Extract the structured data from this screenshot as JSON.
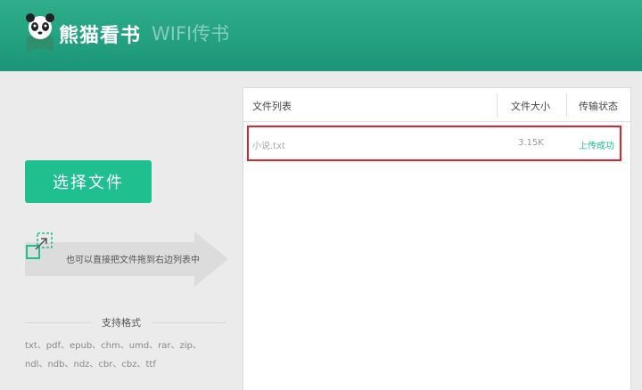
{
  "header": {
    "app_name": "熊猫看书",
    "subtitle": "WIFI传书"
  },
  "left": {
    "select_button": "选择文件",
    "drag_hint": "也可以直接把文件拖到右边列表中",
    "formats_title": "支持格式",
    "formats_line1": "txt、pdf、epub、chm、umd、rar、zip、",
    "formats_line2": "ndl、ndb、ndz、cbr、cbz、ttf"
  },
  "table": {
    "columns": [
      "文件列表",
      "文件大小",
      "传输状态"
    ],
    "rows": [
      {
        "name": "小说.txt",
        "size": "3.15K",
        "status": "上传成功"
      }
    ]
  },
  "colors": {
    "header": "#1fa07f",
    "accent": "#1fbf8f",
    "highlight": "#d9252e"
  }
}
